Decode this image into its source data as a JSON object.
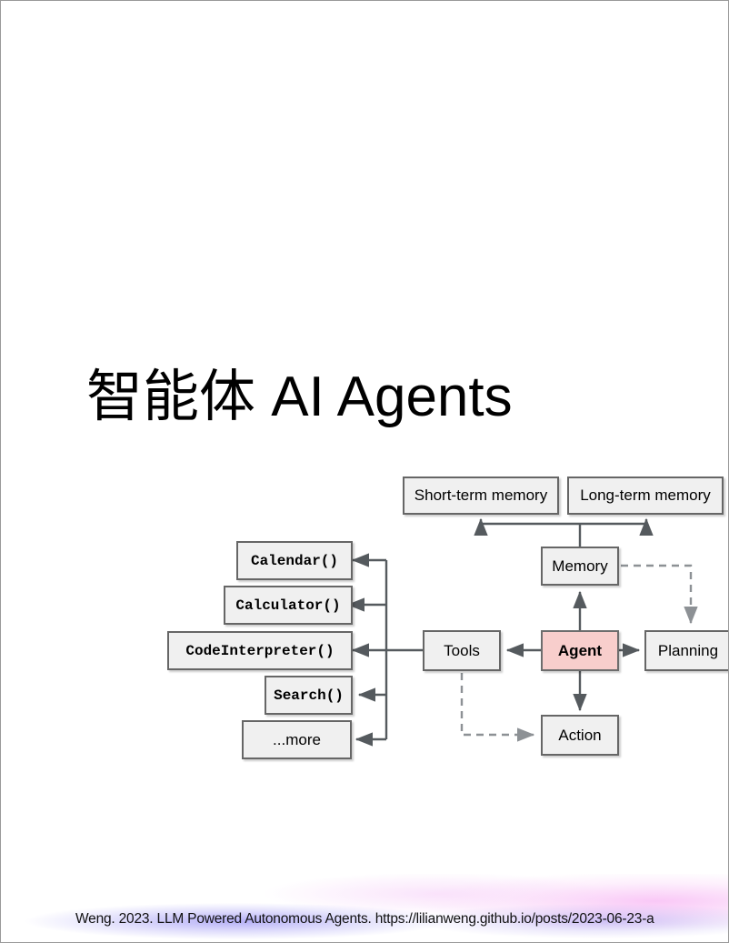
{
  "slide": {
    "title": "智能体 AI Agents",
    "background_color": "#ffffff",
    "border_color": "#9a9a9a"
  },
  "footer": {
    "citation": "Weng. 2023. LLM Powered Autonomous Agents. https://lilianweng.github.io/posts/2023-06-23-a",
    "glow_colors": [
      "#786ef0",
      "#f8bef5"
    ]
  },
  "diagram": {
    "type": "flowchart",
    "node_fill": "#f0f0f0",
    "node_border": "#666666",
    "agent_fill": "#f8cecc",
    "nodes": [
      {
        "id": "short_term",
        "label": "Short-term memory",
        "style": "plain"
      },
      {
        "id": "long_term",
        "label": "Long-term memory",
        "style": "plain"
      },
      {
        "id": "memory",
        "label": "Memory",
        "style": "plain"
      },
      {
        "id": "planning",
        "label": "Planning",
        "style": "plain"
      },
      {
        "id": "agent",
        "label": "Agent",
        "style": "highlight"
      },
      {
        "id": "tools",
        "label": "Tools",
        "style": "plain"
      },
      {
        "id": "action",
        "label": "Action",
        "style": "plain"
      },
      {
        "id": "calendar",
        "label": "Calendar()",
        "style": "mono"
      },
      {
        "id": "calculator",
        "label": "Calculator()",
        "style": "mono"
      },
      {
        "id": "code_interpreter",
        "label": "CodeInterpreter()",
        "style": "mono"
      },
      {
        "id": "search",
        "label": "Search()",
        "style": "mono"
      },
      {
        "id": "more",
        "label": "...more",
        "style": "plain"
      }
    ],
    "edges": [
      {
        "from": "memory",
        "to": "short_term",
        "style": "solid"
      },
      {
        "from": "memory",
        "to": "long_term",
        "style": "solid"
      },
      {
        "from": "agent",
        "to": "memory",
        "style": "solid"
      },
      {
        "from": "agent",
        "to": "planning",
        "style": "solid"
      },
      {
        "from": "agent",
        "to": "tools",
        "style": "solid"
      },
      {
        "from": "agent",
        "to": "action",
        "style": "solid"
      },
      {
        "from": "memory",
        "to": "planning",
        "style": "dashed"
      },
      {
        "from": "tools",
        "to": "action",
        "style": "dashed"
      },
      {
        "from": "tools",
        "to": "calendar",
        "style": "solid"
      },
      {
        "from": "tools",
        "to": "calculator",
        "style": "solid"
      },
      {
        "from": "tools",
        "to": "code_interpreter",
        "style": "solid"
      },
      {
        "from": "tools",
        "to": "search",
        "style": "solid"
      },
      {
        "from": "tools",
        "to": "more",
        "style": "solid"
      }
    ]
  }
}
